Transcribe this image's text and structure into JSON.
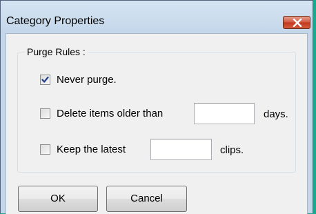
{
  "window": {
    "title": "Category Properties",
    "close_icon": "close-x-icon",
    "accent_close_color": "#c94a2f"
  },
  "purge_rules": {
    "group_label": "Purge Rules :",
    "never_purge": {
      "label": "Never purge.",
      "checked": true
    },
    "delete_older": {
      "label": "Delete items older than",
      "checked": false,
      "value": "",
      "unit": "days."
    },
    "keep_latest": {
      "label": "Keep the latest",
      "checked": false,
      "value": "",
      "unit": "clips."
    }
  },
  "buttons": {
    "ok_label": "OK",
    "cancel_label": "Cancel"
  }
}
